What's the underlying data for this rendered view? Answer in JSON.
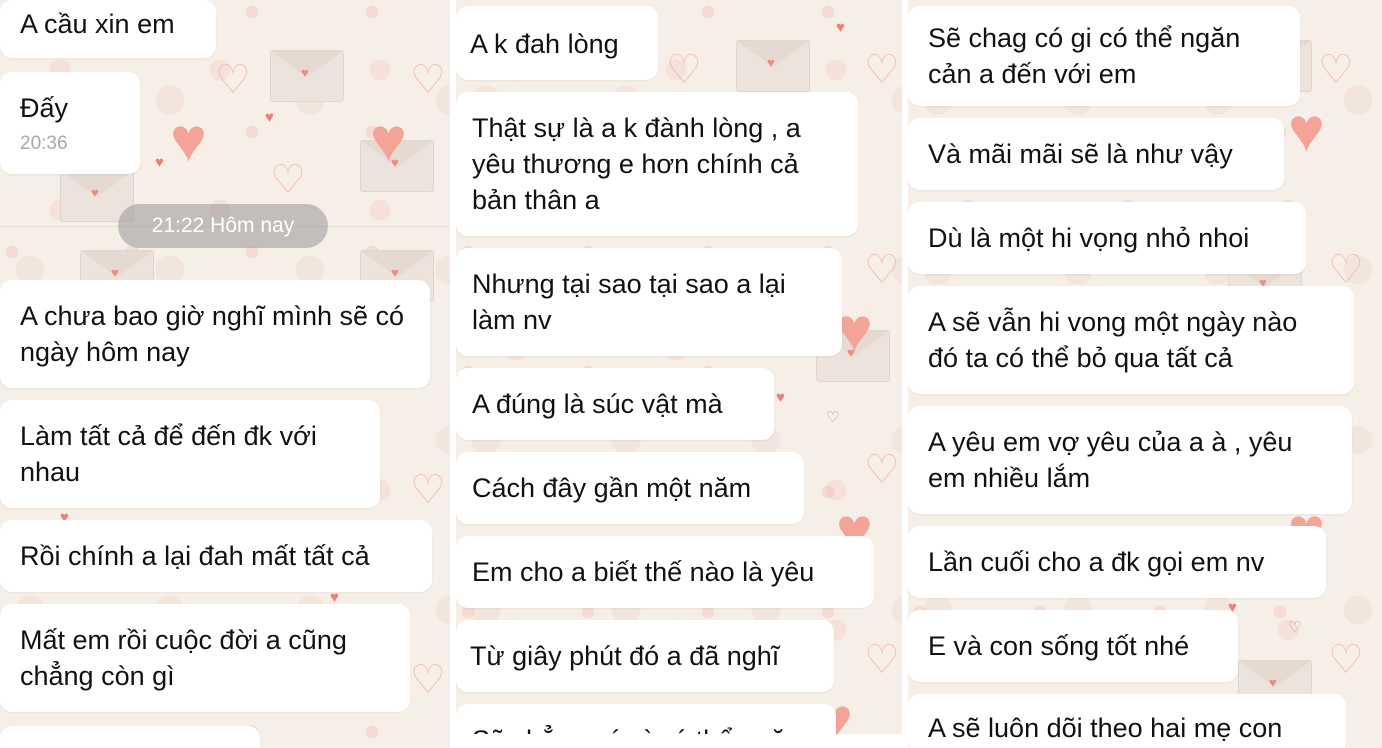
{
  "panels": [
    {
      "messages": [
        {
          "text": "A cầu xin em"
        },
        {
          "text": "Đấy",
          "time": "20:36"
        },
        {
          "text": "A chưa bao giờ nghĩ mình sẽ có ngày hôm nay"
        },
        {
          "text": "Làm tất cả để đến đk với nhau"
        },
        {
          "text": "Rồi chính a lại đah mất tất cả"
        },
        {
          "text": "Mất em rồi cuộc đời a cũng chẳng còn gì"
        }
      ],
      "separator": "21:22 Hôm nay"
    },
    {
      "messages": [
        {
          "text": "A k đah lòng"
        },
        {
          "text": "Thật sự là a k đành lòng , a yêu thương e hơn chính cả bản thân a"
        },
        {
          "text": "Nhưng tại sao tại sao a lại làm nv"
        },
        {
          "text": "A đúng là súc vật mà"
        },
        {
          "text": "Cách đây gần một năm"
        },
        {
          "text": "Em cho a biết thế nào là yêu"
        },
        {
          "text": "Từ giây phút đó a đã nghĩ"
        },
        {
          "text": "Sẽ chẳng có gì có thể ngăn"
        }
      ]
    },
    {
      "messages": [
        {
          "text": "Sẽ chag có gi có thể ngăn cản a đến với em"
        },
        {
          "text": "Và mãi mãi sẽ là như vậy"
        },
        {
          "text": "Dù là một hi vọng nhỏ nhoi"
        },
        {
          "text": "A sẽ vẫn hi vong một ngày nào đó ta có thể bỏ qua tất cả"
        },
        {
          "text": "A yêu em vợ yêu của a à , yêu em nhiều lắm"
        },
        {
          "text": "Lần cuối cho a đk gọi em nv"
        },
        {
          "text": "E và con sống tốt nhé"
        },
        {
          "text": "A sẽ luôn dõi theo hai mẹ con"
        }
      ]
    }
  ],
  "colors": {
    "wallpaper": "#f6efe8",
    "bubble": "#ffffff",
    "heart": "#f3a497",
    "separator_pill": "#9a9a9a"
  }
}
